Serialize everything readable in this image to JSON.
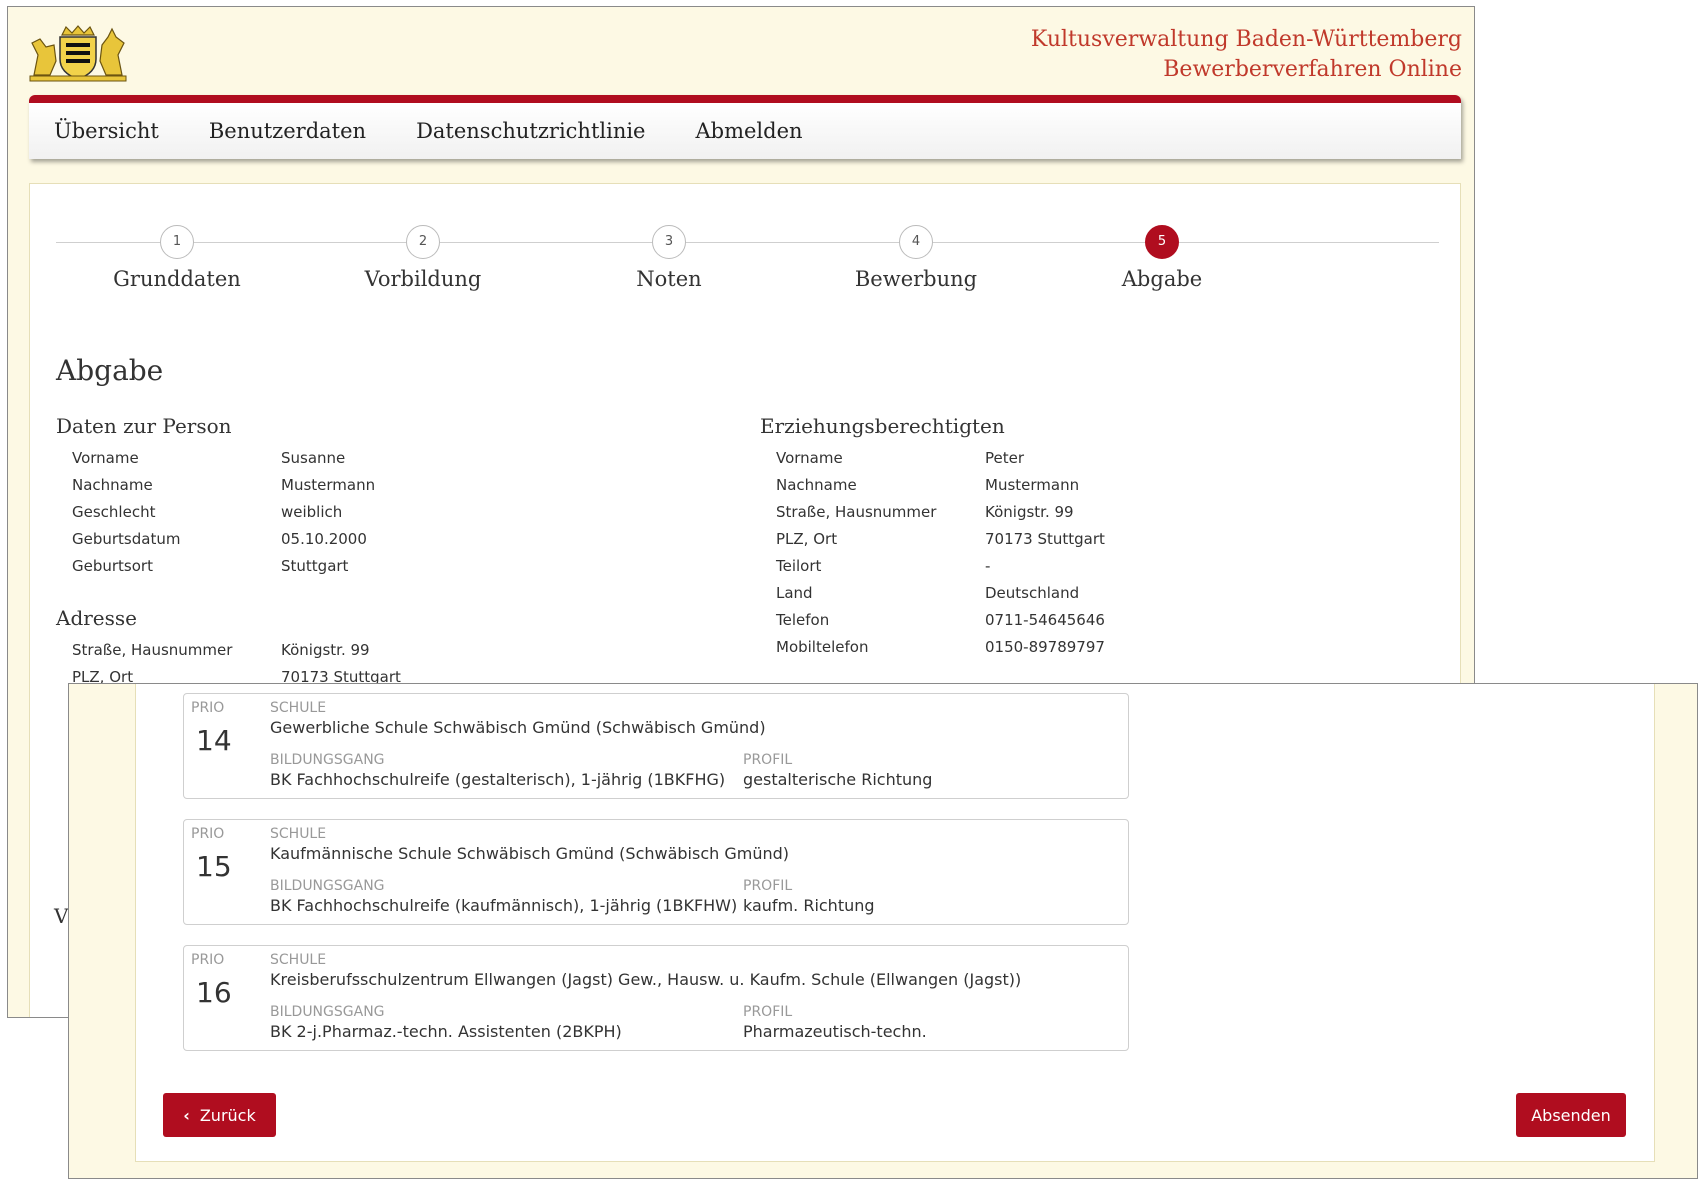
{
  "header": {
    "brand_line1": "Kultusverwaltung Baden-Württemberg",
    "brand_line2": "Bewerberverfahren Online",
    "logo_icon": "coat-of-arms-icon"
  },
  "nav": {
    "items": [
      "Übersicht",
      "Benutzerdaten",
      "Datenschutzrichtlinie",
      "Abmelden"
    ]
  },
  "stepper": {
    "steps": [
      {
        "num": "1",
        "label": "Grunddaten"
      },
      {
        "num": "2",
        "label": "Vorbildung"
      },
      {
        "num": "3",
        "label": "Noten"
      },
      {
        "num": "4",
        "label": "Bewerbung"
      },
      {
        "num": "5",
        "label": "Abgabe"
      }
    ],
    "active": "5"
  },
  "page_title": "Abgabe",
  "person": {
    "heading": "Daten zur Person",
    "rows": [
      {
        "k": "Vorname",
        "v": "Susanne"
      },
      {
        "k": "Nachname",
        "v": "Mustermann"
      },
      {
        "k": "Geschlecht",
        "v": "weiblich"
      },
      {
        "k": "Geburtsdatum",
        "v": "05.10.2000"
      },
      {
        "k": "Geburtsort",
        "v": "Stuttgart"
      }
    ]
  },
  "address": {
    "heading": "Adresse",
    "rows": [
      {
        "k": "Straße, Hausnummer",
        "v": "Königstr. 99"
      },
      {
        "k": "PLZ, Ort",
        "v": "70173 Stuttgart"
      }
    ]
  },
  "guardian": {
    "heading": "Erziehungsberechtigten",
    "rows": [
      {
        "k": "Vorname",
        "v": "Peter"
      },
      {
        "k": "Nachname",
        "v": "Mustermann"
      },
      {
        "k": "Straße, Hausnummer",
        "v": "Königstr. 99"
      },
      {
        "k": "PLZ, Ort",
        "v": "70173 Stuttgart"
      },
      {
        "k": "Teilort",
        "v": "-"
      },
      {
        "k": "Land",
        "v": "Deutschland"
      },
      {
        "k": "Telefon",
        "v": "0711-54645646"
      },
      {
        "k": "Mobiltelefon",
        "v": "0150-89789797"
      }
    ]
  },
  "obscured_heading_stub": "V",
  "labels": {
    "prio": "PRIO",
    "schule": "SCHULE",
    "bildungsgang": "BILDUNGSGANG",
    "profil": "PROFIL"
  },
  "applications": [
    {
      "prio": "14",
      "schule": "Gewerbliche Schule Schwäbisch Gmünd (Schwäbisch Gmünd)",
      "bildungsgang": "BK Fachhochschulreife (gestalterisch), 1-jährig (1BKFHG)",
      "profil": "gestalterische Richtung"
    },
    {
      "prio": "15",
      "schule": "Kaufmännische Schule Schwäbisch Gmünd (Schwäbisch Gmünd)",
      "bildungsgang": "BK Fachhochschulreife (kaufmännisch), 1-jährig (1BKFHW)",
      "profil": "kaufm. Richtung"
    },
    {
      "prio": "16",
      "schule": "Kreisberufsschulzentrum Ellwangen (Jagst) Gew., Hausw. u. Kaufm. Schule (Ellwangen (Jagst))",
      "bildungsgang": "BK 2-j.Pharmaz.-techn. Assistenten (2BKPH)",
      "profil": "Pharmazeutisch-techn."
    }
  ],
  "buttons": {
    "back": "Zurück",
    "submit": "Absenden"
  },
  "colors": {
    "accent": "#b00d1f",
    "brand_text": "#c0392b",
    "page_bg": "#fdf9e4"
  }
}
